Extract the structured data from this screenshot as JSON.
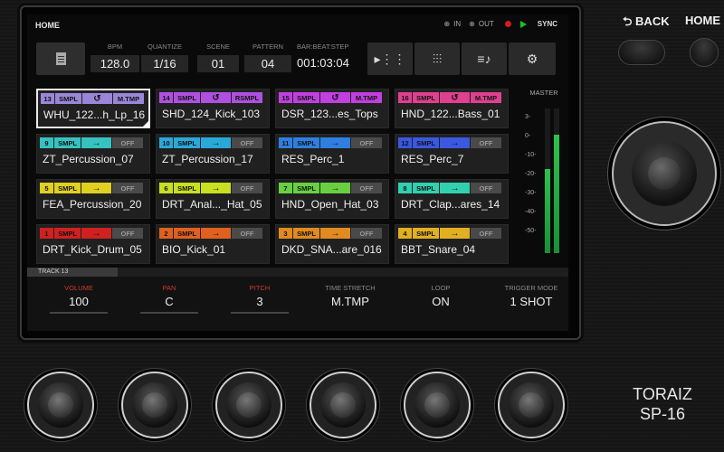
{
  "header": {
    "title": "HOME",
    "in_label": "IN",
    "out_label": "OUT",
    "sync_label": "SYNC"
  },
  "fields": {
    "bpm": {
      "label": "BPM",
      "value": "128.0"
    },
    "quantize": {
      "label": "QUANTIZE",
      "value": "1/16"
    },
    "scene": {
      "label": "SCENE",
      "value": "01"
    },
    "pattern": {
      "label": "PATTERN",
      "value": "04"
    },
    "barbeat": {
      "label": "BAR:BEAT:STEP",
      "value": "001:03:04"
    }
  },
  "toolbar": {
    "sequence_icon": "sequence-icon",
    "mixer_icon": "mixer-icon",
    "browse_icon": "browse-icon",
    "settings_icon": "gear-icon"
  },
  "pads": [
    {
      "num": "13",
      "type": "SMPL",
      "mode": "↺",
      "trigger": "M.TMP",
      "name": "WHU_122...h_Lp_16",
      "color": "#9a86d8",
      "selected": true
    },
    {
      "num": "14",
      "type": "SMPL",
      "mode": "↺",
      "trigger": "RSMPL",
      "name": "SHD_124_Kick_103",
      "color": "#b050e0",
      "selected": false
    },
    {
      "num": "15",
      "type": "SMPL",
      "mode": "↺",
      "trigger": "M.TMP",
      "name": "DSR_123...es_Tops",
      "color": "#c23fe0",
      "selected": false
    },
    {
      "num": "16",
      "type": "SMPL",
      "mode": "↺",
      "trigger": "M.TMP",
      "name": "HND_122...Bass_01",
      "color": "#e04090",
      "selected": false
    },
    {
      "num": "9",
      "type": "SMPL",
      "mode": "→",
      "trigger": "OFF",
      "name": "ZT_Percussion_07",
      "color": "#36c2c0",
      "selected": false
    },
    {
      "num": "10",
      "type": "SMPL",
      "mode": "→",
      "trigger": "OFF",
      "name": "ZT_Percussion_17",
      "color": "#2aa8d8",
      "selected": false
    },
    {
      "num": "11",
      "type": "SMPL",
      "mode": "→",
      "trigger": "OFF",
      "name": "RES_Perc_1",
      "color": "#2e7fe0",
      "selected": false
    },
    {
      "num": "12",
      "type": "SMPL",
      "mode": "→",
      "trigger": "OFF",
      "name": "RES_Perc_7",
      "color": "#3a58e0",
      "selected": false
    },
    {
      "num": "5",
      "type": "SMPL",
      "mode": "→",
      "trigger": "OFF",
      "name": "FEA_Percussion_20",
      "color": "#e0d020",
      "selected": false
    },
    {
      "num": "6",
      "type": "SMPL",
      "mode": "→",
      "trigger": "OFF",
      "name": "DRT_Anal..._Hat_05",
      "color": "#c8e020",
      "selected": false
    },
    {
      "num": "7",
      "type": "SMPL",
      "mode": "→",
      "trigger": "OFF",
      "name": "HND_Open_Hat_03",
      "color": "#68d040",
      "selected": false
    },
    {
      "num": "8",
      "type": "SMPL",
      "mode": "→",
      "trigger": "OFF",
      "name": "DRT_Clap...ares_14",
      "color": "#30d0b0",
      "selected": false
    },
    {
      "num": "1",
      "type": "SMPL",
      "mode": "→",
      "trigger": "OFF",
      "name": "DRT_Kick_Drum_05",
      "color": "#d02020",
      "selected": false
    },
    {
      "num": "2",
      "type": "SMPL",
      "mode": "→",
      "trigger": "OFF",
      "name": "BIO_Kick_01",
      "color": "#e06020",
      "selected": false
    },
    {
      "num": "3",
      "type": "SMPL",
      "mode": "→",
      "trigger": "OFF",
      "name": "DKD_SNA...are_016",
      "color": "#e08a20",
      "selected": false
    },
    {
      "num": "4",
      "type": "SMPL",
      "mode": "→",
      "trigger": "OFF",
      "name": "BBT_Snare_04",
      "color": "#e0b020",
      "selected": false
    }
  ],
  "master": {
    "label": "MASTER",
    "scale": [
      "3-",
      "0-",
      "-10-",
      "-20-",
      "-30-",
      "-40-",
      "-50-"
    ],
    "levels": [
      0.58,
      0.82
    ]
  },
  "track": {
    "label": "TRACK 13"
  },
  "params": [
    {
      "label": "VOLUME",
      "value": "100",
      "accent": true
    },
    {
      "label": "PAN",
      "value": "C",
      "accent": true
    },
    {
      "label": "PITCH",
      "value": "3",
      "accent": true
    },
    {
      "label": "TIME STRETCH",
      "value": "M.TMP",
      "accent": false
    },
    {
      "label": "LOOP",
      "value": "ON",
      "accent": false
    },
    {
      "label": "TRIGGER MODE",
      "value": "1 SHOT",
      "accent": false
    }
  ],
  "hardware": {
    "back_label": "BACK",
    "home_label": "HOME",
    "brand_line1": "TORAIZ",
    "brand_line2": "SP-16"
  }
}
